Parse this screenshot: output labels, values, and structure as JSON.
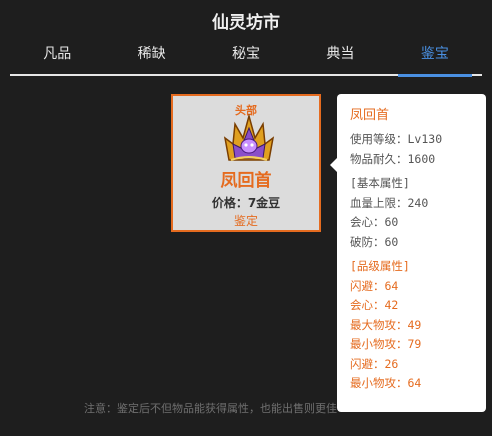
{
  "title": "仙灵坊市",
  "tabs": [
    {
      "label": "凡品",
      "active": false
    },
    {
      "label": "稀缺",
      "active": false
    },
    {
      "label": "秘宝",
      "active": false
    },
    {
      "label": "典当",
      "active": false
    },
    {
      "label": "鉴宝",
      "active": true
    }
  ],
  "item": {
    "slot": "头部",
    "icon": "flaming-crown-helmet-icon",
    "name": "凤回首",
    "price": "价格：7金豆",
    "action": "鉴定"
  },
  "tooltip": {
    "name": "凤回首",
    "level": "使用等级：Lv130",
    "durability": "物品耐久：1600",
    "base_header": "[基本属性]",
    "base_stats": [
      "血量上限：240",
      "会心：60",
      "破防：60"
    ],
    "quality_header": "[品级属性]",
    "quality_stats": [
      "闪避：64",
      "会心：42",
      "最大物攻：49",
      "最小物攻：79",
      "闪避：26",
      "最小物攻：64"
    ]
  },
  "footer_note": "注意：鉴定后不但物品能获得属性，也能出售则更佳",
  "colors": {
    "background": "#1e1e1e",
    "accent_orange": "#e56b1f",
    "tab_active": "#4a90e2",
    "card_bg": "#dcdcdc"
  }
}
